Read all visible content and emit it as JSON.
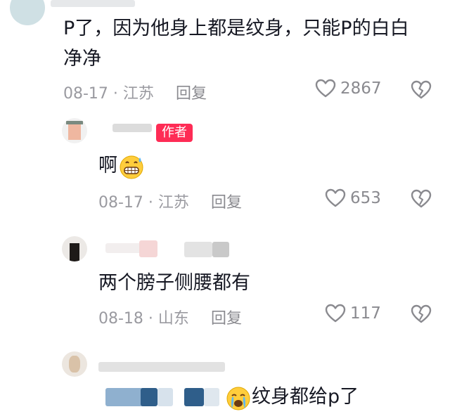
{
  "comments": [
    {
      "text_line1": "P了，因为他身上都是纹身，只能P的白白",
      "text_line2": "净净",
      "time": "08-17 · 江苏",
      "reply_label": "回复",
      "likes": "2867"
    },
    {
      "author_badge": "作者",
      "text": "啊",
      "time": "08-17 · 江苏",
      "reply_label": "回复",
      "likes": "653"
    },
    {
      "text": "两个膀子侧腰都有",
      "time": "08-18 · 山东",
      "reply_label": "回复",
      "likes": "117"
    },
    {
      "text": "纹身都给p了"
    }
  ],
  "icons": {
    "like": "heart-outline-icon",
    "dislike": "broken-heart-icon",
    "emoji_grin": "grimacing-sweat-emoji",
    "emoji_cry": "crying-emoji"
  },
  "colors": {
    "text": "#161823",
    "meta": "#9a9aa0",
    "badge": "#fe2c55"
  }
}
